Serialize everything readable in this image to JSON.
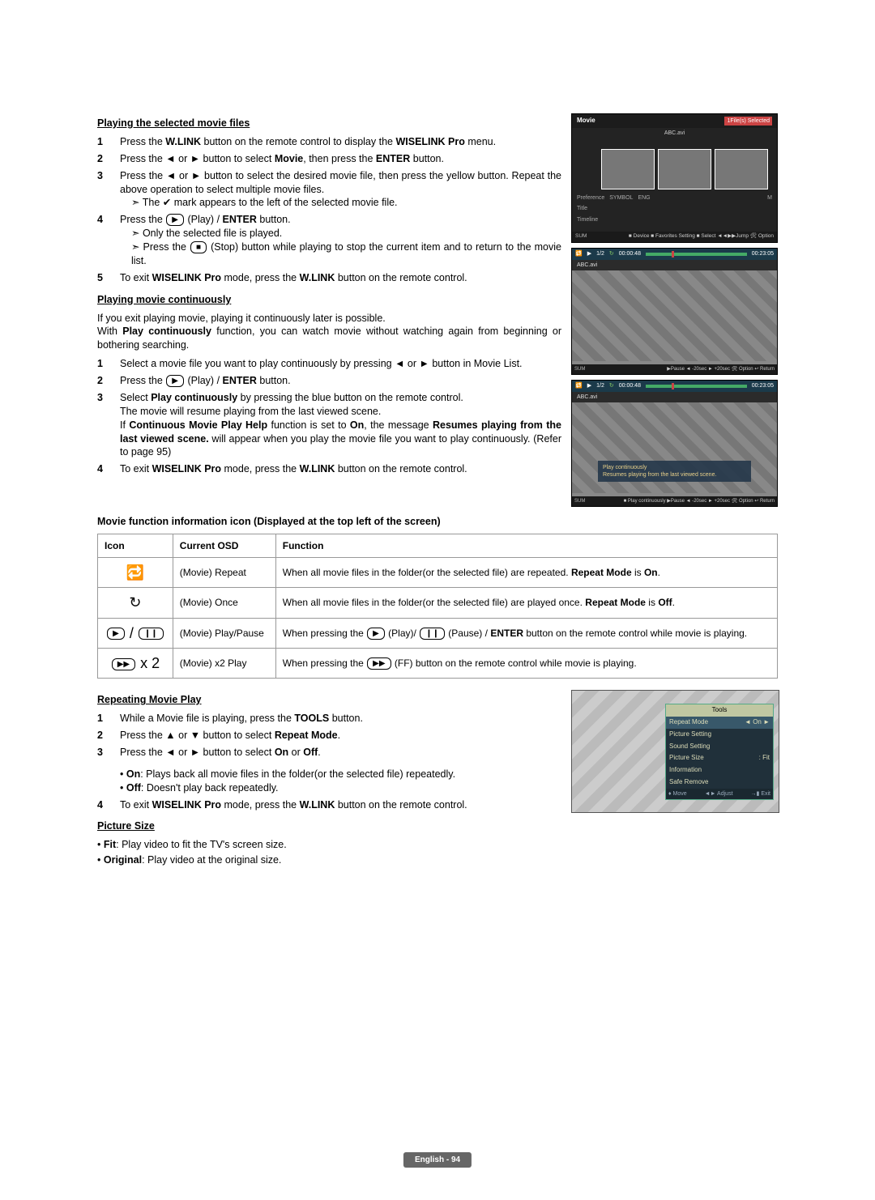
{
  "section1": {
    "title": "Playing the selected movie files",
    "steps": [
      {
        "n": "1",
        "html": "Press the <span class='b'>W.LINK</span> button on the remote control to display the <span class='b'>WISELINK Pro</span> menu."
      },
      {
        "n": "2",
        "html": "Press the ◄ or ► button to select <span class='b'>Movie</span>, then press the <span class='b'>ENTER</span> button."
      },
      {
        "n": "3",
        "html": "Press the ◄ or ► button to select the desired movie file, then press the yellow button. Repeat the above operation to select multiple movie files.<div class='sub arrow'>The ✔ mark appears to the left of the selected movie file.</div>"
      },
      {
        "n": "4",
        "html": "Press the <span class='keyicon'>▶</span> (Play) / <span class='b'>ENTER</span> button.<div class='sub arrow'>Only the selected file is played.</div><div class='sub arrow'>Press the <span class='keyicon'>■</span> (Stop) button while playing to stop the current item and to return to the movie list.</div>"
      },
      {
        "n": "5",
        "html": "To exit <span class='b'>WISELINK Pro</span> mode, press the <span class='b'>W.LINK</span> button on the remote control."
      }
    ]
  },
  "section2": {
    "title": "Playing movie continuously",
    "intro": "If you exit playing movie, playing it continuously later is possible.<br>With <span class='b'>Play continuously</span> function, you can watch movie without watching again from beginning or bothering searching.",
    "steps": [
      {
        "n": "1",
        "html": "Select a movie file you want to play continuously by pressing ◄ or ► button in Movie List."
      },
      {
        "n": "2",
        "html": "Press the <span class='keyicon'>▶</span> (Play) / <span class='b'>ENTER</span> button."
      },
      {
        "n": "3",
        "html": "Select <span class='b'>Play continuously</span> by pressing the blue button on the remote control.<br>The movie will resume playing from the last viewed scene.<br>If <span class='b'>Continuous Movie Play Help</span> function is set to <span class='b'>On</span>, the message <span class='b'>Resumes playing from the last viewed scene.</span> will appear when you play the movie file you want to play continuously. (Refer to page 95)"
      },
      {
        "n": "4",
        "html": "To exit <span class='b'>WISELINK Pro</span> mode, press the <span class='b'>W.LINK</span> button on the remote control."
      }
    ]
  },
  "tableTitle": "Movie function information icon (Displayed at the top left of the screen)",
  "table": {
    "headers": [
      "Icon",
      "Current OSD",
      "Function"
    ],
    "rows": [
      {
        "icon": "🔁",
        "osd": "(Movie) Repeat",
        "func": "When all movie files in the folder(or the selected file) are repeated. <span class='b'>Repeat Mode</span> is <span class='b'>On</span>."
      },
      {
        "icon": "↻",
        "osd": "(Movie) Once",
        "func": "When all movie files in the folder(or the selected file) are played once. <span class='b'>Repeat Mode</span> is <span class='b'>Off</span>."
      },
      {
        "icon": "<span class='keyicon'>▶</span> / <span class='keyicon'>❙❙</span>",
        "osd": "(Movie) Play/Pause",
        "func": "When pressing the <span class='keyicon'>▶</span> (Play)/ <span class='keyicon'>❙❙</span> (Pause) / <span class='b'>ENTER</span> button on the remote control while movie is playing."
      },
      {
        "icon": "<span class='keyicon'>▶▶</span> x 2",
        "osd": "(Movie) x2 Play",
        "func": "When pressing the <span class='keyicon'>▶▶</span> (FF) button on the remote control while movie is playing."
      }
    ]
  },
  "section3": {
    "title": "Repeating Movie Play",
    "steps": [
      {
        "n": "1",
        "html": "While a Movie file is playing, press the <span class='b'>TOOLS</span> button."
      },
      {
        "n": "2",
        "html": "Press the ▲ or ▼ button to select <span class='b'>Repeat Mode</span>."
      },
      {
        "n": "3",
        "html": "Press the ◄ or ► button to select <span class='b'>On</span> or <span class='b'>Off</span>."
      }
    ],
    "opts": [
      {
        "html": "<span class='b'>On</span>: Plays back all movie files in the folder(or the selected file) repeatedly."
      },
      {
        "html": "<span class='b'>Off</span>: Doesn't play back repeatedly."
      }
    ],
    "after": [
      {
        "n": "4",
        "html": "To exit <span class='b'>WISELINK Pro</span> mode, press the <span class='b'>W.LINK</span> button on the remote control."
      }
    ]
  },
  "section4": {
    "title": "Picture Size",
    "bullets": [
      {
        "html": "<span class='b'>Fit</span>: Play video to fit the TV's screen size."
      },
      {
        "html": "<span class='b'>Original</span>: Play video at the original size."
      }
    ]
  },
  "shot1": {
    "title": "Movie",
    "filesel": "1File(s) Selected",
    "filename": "ABC.avi",
    "pref": "Preference",
    "symbol": "SYMBOL",
    "eng": "ENG",
    "m": "M",
    "titlelab": "Title",
    "timeline": "Timeline",
    "sum": "SUM",
    "hints": "■ Device  ■ Favorites Setting  ■ Select  ◄◄▶▶Jump  🛠 Option"
  },
  "shot2": {
    "index": "1/2",
    "t1": "00:00:48",
    "t2": "00:23:05",
    "filename": "ABC.avi",
    "sum": "SUM",
    "hints": "▶Pause  ◄ -20sec  ► +20sec  🛠 Option  ↩ Return"
  },
  "shot3": {
    "index": "1/2",
    "t1": "00:00:48",
    "t2": "00:23:05",
    "filename": "ABC.avi",
    "msg": "Play continuously<br>Resumes playing from the last viewed scene.",
    "sum": "SUM",
    "hints": "■ Play continuously  ▶Pause  ◄ -20sec  ► +20sec  🛠 Option  ↩ Return"
  },
  "tools": {
    "title": "Tools",
    "rows": [
      {
        "l": "Repeat Mode",
        "r": "◄   On   ►",
        "sel": true
      },
      {
        "l": "Picture Setting",
        "r": ""
      },
      {
        "l": "Sound Setting",
        "r": ""
      },
      {
        "l": "Picture Size",
        "r": ":        Fit"
      },
      {
        "l": "Information",
        "r": ""
      },
      {
        "l": "Safe Remove",
        "r": ""
      }
    ],
    "foot": {
      "a": "♦ Move",
      "b": "◄► Adjust",
      "c": "→▮ Exit"
    }
  },
  "footer": "English - 94"
}
